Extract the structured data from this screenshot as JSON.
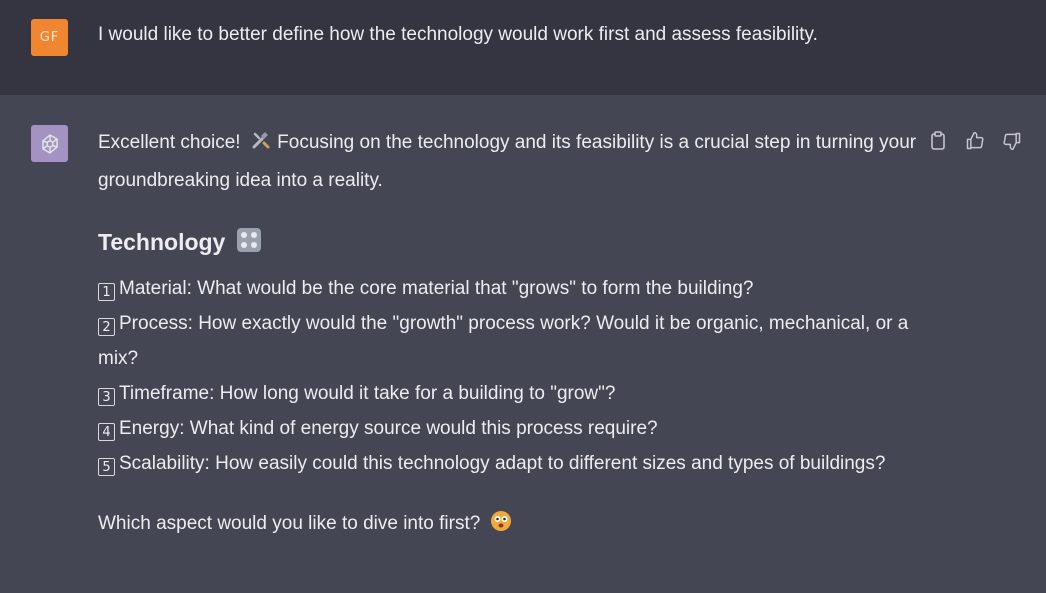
{
  "user": {
    "avatar_initials": "GF",
    "avatar_color": "#f0862f",
    "message": "I would like to better define how the technology would work first and assess feasibility."
  },
  "assistant": {
    "avatar_icon": "openai-logo-icon",
    "intro_part1": "Excellent choice!",
    "intro_emoji": "tools-emoji-icon",
    "intro_part2": "Focusing on the technology and its feasibility is a crucial step in turning your groundbreaking idea into a reality.",
    "heading": "Technology",
    "heading_emoji": "control-knobs-emoji-icon",
    "items": [
      {
        "num": "1",
        "text": "Material: What would be the core material that \"grows\" to form the building?"
      },
      {
        "num": "2",
        "text": "Process: How exactly would the \"growth\" process work? Would it be organic, mechanical, or a mix?"
      },
      {
        "num": "3",
        "text": "Timeframe: How long would it take for a building to \"grow\"?"
      },
      {
        "num": "4",
        "text": "Energy: What kind of energy source would this process require?"
      },
      {
        "num": "5",
        "text": "Scalability: How easily could this technology adapt to different sizes and types of buildings?"
      }
    ],
    "closing": "Which aspect would you like to dive into first?",
    "closing_emoji": "face-emoji-icon"
  },
  "actions": [
    "copy-icon",
    "thumbs-up-icon",
    "thumbs-down-icon"
  ],
  "colors": {
    "user_bg": "#343541",
    "assistant_bg": "#444654",
    "text": "#ececf1"
  }
}
